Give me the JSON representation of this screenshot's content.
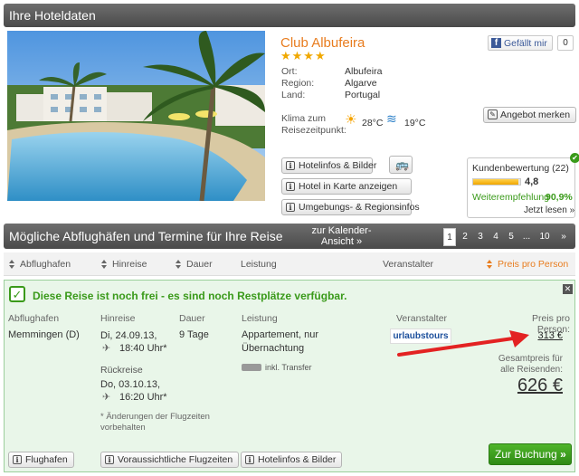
{
  "section1": {
    "title": "Ihre Hoteldaten"
  },
  "hotel": {
    "name": "Club Albufeira",
    "stars": "★★★★",
    "ort_label": "Ort:",
    "ort": "Albufeira",
    "region_label": "Region:",
    "region": "Algarve",
    "land_label": "Land:",
    "land": "Portugal",
    "klima_label_1": "Klima zum",
    "klima_label_2": "Reisezeitpunkt:",
    "air_temp": "28°C",
    "water_temp": "19°C"
  },
  "facebook": {
    "label": "Gefällt mir",
    "count": "0"
  },
  "buttons": {
    "merken": "Angebot merken",
    "hotelinfos": "Hotelinfos & Bilder",
    "karte": "Hotel in Karte anzeigen",
    "umgebung": "Umgebungs- & Regionsinfos"
  },
  "rating": {
    "title": "Kundenbewertung (22)",
    "score": "4,8",
    "score_fraction": 0.96,
    "recommend_label": "Weiterempfehlung",
    "recommend_value": "90,9%",
    "read_more": "Jetzt lesen »"
  },
  "section2": {
    "title": "Mögliche Abflughäfen und Termine für Ihre Reise",
    "calendar_line1": "zur Kalender-",
    "calendar_line2": "Ansicht »",
    "pages": [
      "1",
      "2",
      "3",
      "4",
      "5",
      "...",
      "10",
      "»"
    ],
    "active_page": "1"
  },
  "sort": {
    "abflughafen": "Abflughafen",
    "hinreise": "Hinreise",
    "dauer": "Dauer",
    "leistung": "Leistung",
    "veranstalter": "Veranstalter",
    "preis": "Preis pro Person"
  },
  "offer": {
    "headline": "Diese Reise ist noch frei - es sind noch Restplätze verfügbar.",
    "col_abflughafen": "Abflughafen",
    "col_hinreise": "Hinreise",
    "col_dauer": "Dauer",
    "col_leistung": "Leistung",
    "col_veranstalter": "Veranstalter",
    "col_preis": "Preis pro Person:",
    "abflughafen": "Memmingen (D)",
    "hin_date": "Di, 24.09.13,",
    "hin_time": "18:40 Uhr*",
    "dauer": "9 Tage",
    "leistung_1": "Appartement, nur",
    "leistung_2": "Übernachtung",
    "transfer": "inkl. Transfer",
    "veranstalter_logo": "urlaubstours",
    "price": "313 €",
    "rueckreise_label": "Rückreise",
    "rueck_date": "Do, 03.10.13,",
    "rueck_time": "16:20 Uhr*",
    "gesamt_1": "Gesamtpreis für",
    "gesamt_2": "alle Reisenden:",
    "total": "626 €",
    "hinweis_1": "* Änderungen der Flugzeiten",
    "hinweis_2": "vorbehalten",
    "btn_flughafen": "Flughafen",
    "btn_flugzeiten": "Voraussichtliche Flugzeiten",
    "btn_hotelinfos": "Hotelinfos & Bilder",
    "btn_buchung": "Zur Buchung"
  },
  "colors": {
    "accent": "#e87c1e",
    "green": "#3a9a1a",
    "red_arrow": "#e32222",
    "bar": "#555555"
  }
}
